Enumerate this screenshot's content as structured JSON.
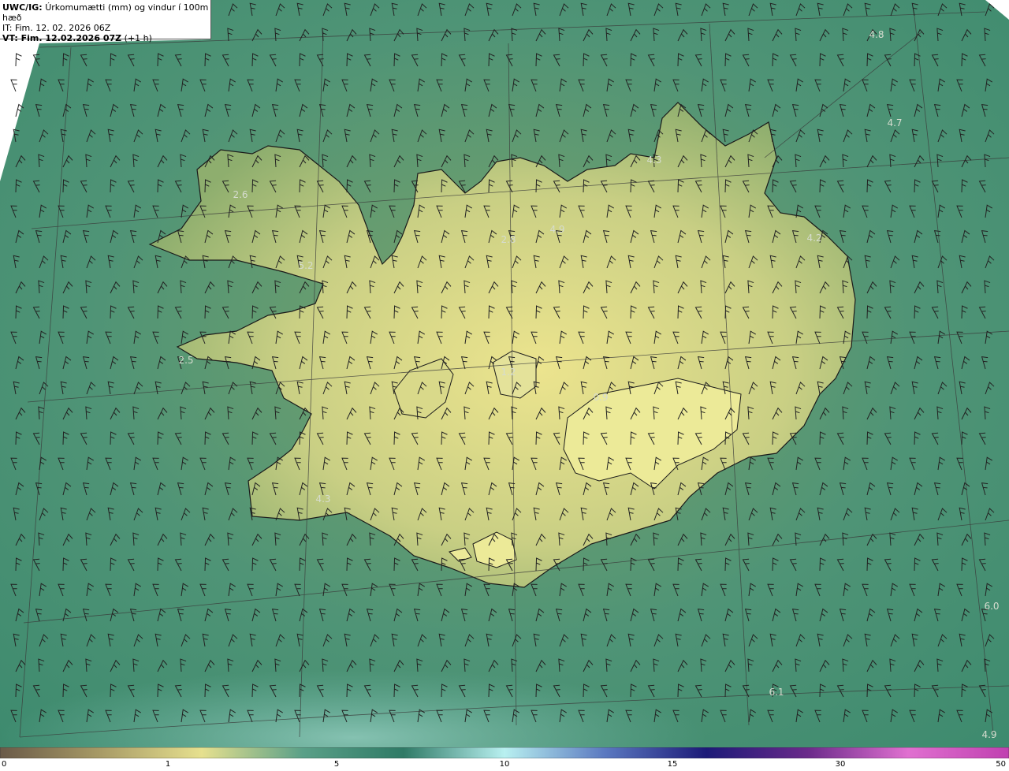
{
  "header": {
    "product": "UWC/IG:",
    "title": "Úrkomumætti (mm) og vindur í 100m hæð",
    "it_line": "IT: Fim. 12. 02. 2026 06Z",
    "vt_label": "VT: Fim. 12.02.2026 07Z",
    "vt_offset": "(+1 h)"
  },
  "colors": {
    "sea_deep": "#3f8a70",
    "sea_light": "#6fb3a2",
    "land_low": "#8fae6a",
    "land_high": "#e6e08e",
    "coastline": "#1a1a1a",
    "graticule": "#3a3a3a",
    "barb": "#222222",
    "label": "#d6dccf"
  },
  "map_labels": [
    {
      "text": "4.8"
    },
    {
      "text": "4.7"
    },
    {
      "text": "4.3"
    },
    {
      "text": "2.6"
    },
    {
      "text": "5.2"
    },
    {
      "text": "2.8"
    },
    {
      "text": "4.9"
    },
    {
      "text": "4.2"
    },
    {
      "text": "2.5"
    },
    {
      "text": "1.2"
    },
    {
      "text": "0.9"
    },
    {
      "text": "4.3"
    },
    {
      "text": "6.0"
    },
    {
      "text": "6.1"
    },
    {
      "text": "4.9"
    }
  ],
  "colorbar": {
    "stops": [
      "#6a5a48",
      "#a89b66",
      "#e6e08e",
      "#5aa088",
      "#2f7a66",
      "#b8f0f0",
      "#5a78c0",
      "#1c1a78",
      "#6a2a8a",
      "#e070d0",
      "#c040b0"
    ],
    "ticks": [
      {
        "value": 0,
        "text": "0"
      },
      {
        "value": 1,
        "text": "1"
      },
      {
        "value": 5,
        "text": "5"
      },
      {
        "value": 10,
        "text": "10"
      },
      {
        "value": 15,
        "text": "15"
      },
      {
        "value": 30,
        "text": "30"
      },
      {
        "value": 50,
        "text": "50"
      }
    ]
  }
}
